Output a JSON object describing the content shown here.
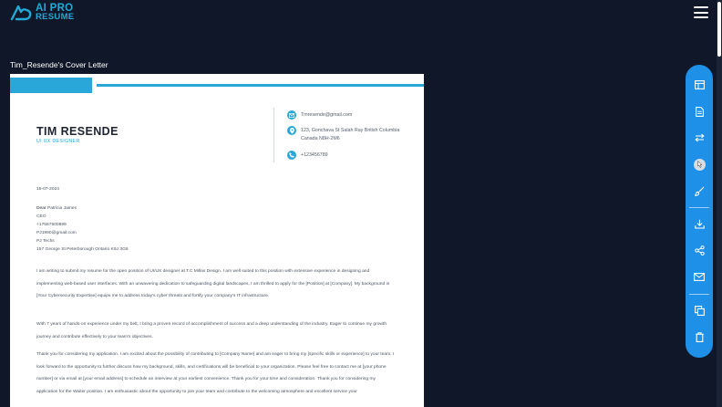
{
  "app": {
    "logo_line1": "AI PRO",
    "logo_line2": "RESUME"
  },
  "document": {
    "title": "Tim_Resende's Cover Letter"
  },
  "letter": {
    "name": "TIM RESENDE",
    "role": "UI UX DESIGNER",
    "email": "Tmresende@gmail.com",
    "address": "123, Gonchava St Salah Ray British Columbia Canada N8H-2M6",
    "phone": "+123456789",
    "date": "15-07-2024",
    "dear_prefix": "Dear",
    "recipient_name": "Patricia James",
    "recipient_title": "CEO",
    "recipient_phone": "+17567500899",
    "recipient_email": "PJ1990@gmail.com",
    "recipient_company": "PJ Techs",
    "recipient_address": "157 George St Peterborough Ontario K9J 3G6",
    "paragraph1": "I am writing to submit my resume for the open position of UI/UX designer at T.C Millas Design. I am well suited to this position with extensive experience in designing and implementing web-based user interfaces. With an unwavering dedication to safeguarding digital landscapes, I am thrilled to apply for the [Position] at [Company]. My background in [Your Cybersecurity Expertise] equips me to address today's cyber threats and fortify your company's IT infrastructure.",
    "paragraph2": "With 7 years of hands-on experience under my belt, I bring a proven record of accomplishment of success and a deep understanding of the industry. Eager to continue my growth journey and contribute effectively to your team's objectives.",
    "paragraph3": "Thank you for considering my application. I am excited about the possibility of contributing to [Company Name] and am eager to bring my [specific skills or experience] to your team. I look forward to the opportunity to further discuss how my background, skills, and certifications will be beneficial to your organization. Please feel free to contact me at [your phone number] or via email at [your email address] to schedule an interview at your earliest convenience. Thank you for your time and consideration. Thank you for considering my application for the Waiter position. I am enthusiastic about the opportunity to join your team and contribute to the welcoming atmosphere and excellent service your"
  },
  "toolbar": {
    "tools": [
      "layout-icon",
      "document-icon",
      "swap-icon",
      "color-icon",
      "brush-icon",
      "download-icon",
      "share-icon",
      "email-icon",
      "copy-icon",
      "delete-icon"
    ]
  },
  "colors": {
    "background": "#0f1729",
    "accent": "#28a7d8",
    "toolbar": "#1e90e8",
    "paper": "#ffffff"
  }
}
